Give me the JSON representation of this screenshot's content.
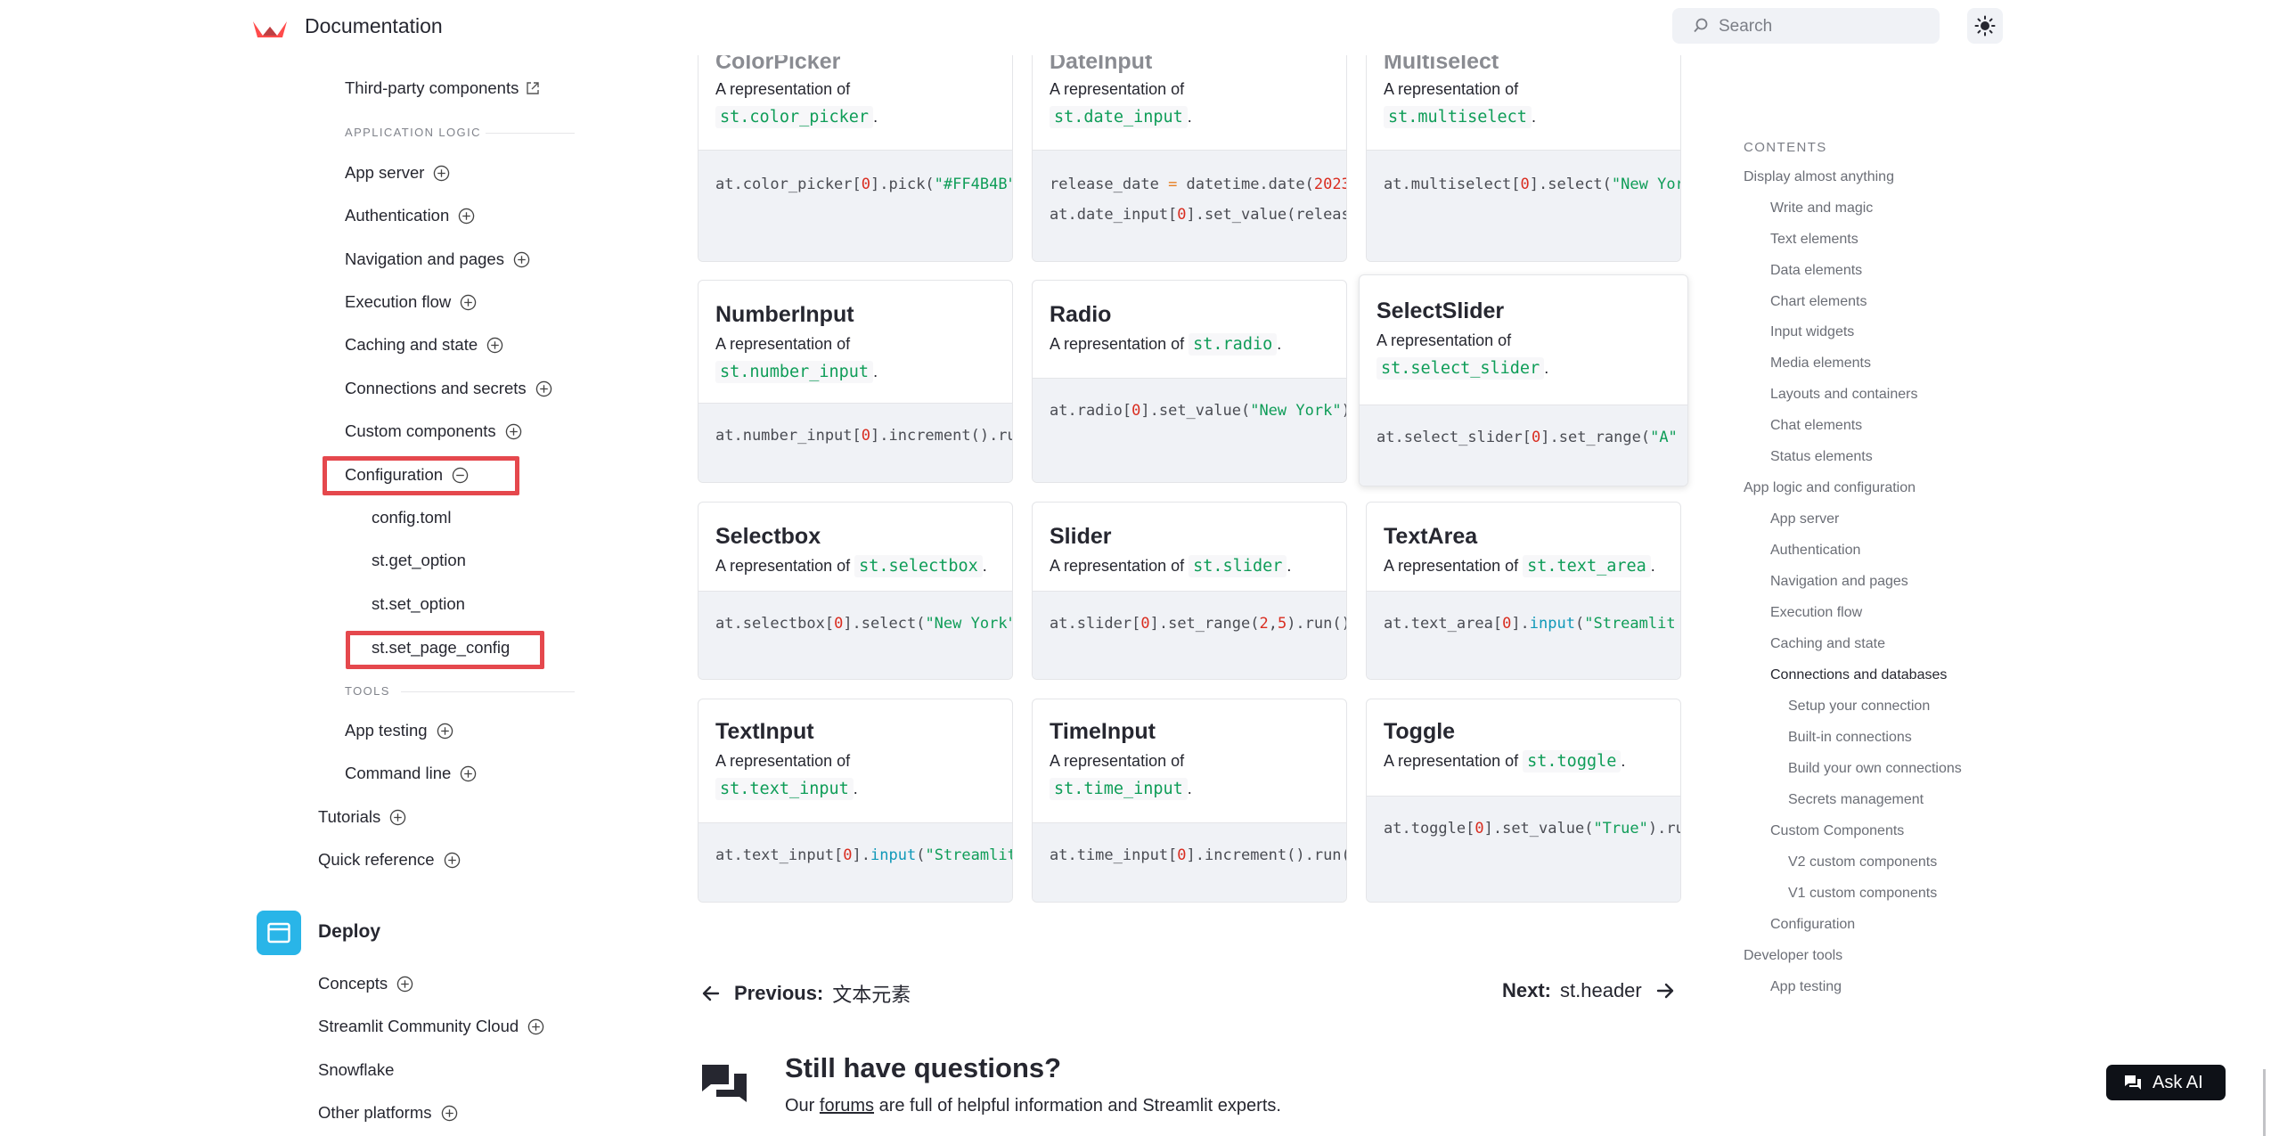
{
  "header": {
    "title": "Documentation",
    "search_placeholder": "Search"
  },
  "sidebar": {
    "third_party": "Third-party components",
    "application_logic_label": "APPLICATION LOGIC",
    "app_server": "App server",
    "authentication": "Authentication",
    "navigation": "Navigation and pages",
    "execution_flow": "Execution flow",
    "caching": "Caching and state",
    "connections": "Connections and secrets",
    "custom_components": "Custom components",
    "configuration": "Configuration",
    "config_toml": "config.toml",
    "get_option": "st.get_option",
    "set_option": "st.set_option",
    "set_page_config": "st.set_page_config",
    "tools_label": "TOOLS",
    "app_testing": "App testing",
    "command_line": "Command line",
    "tutorials": "Tutorials",
    "quick_reference": "Quick reference",
    "deploy": "Deploy",
    "concepts": "Concepts",
    "community_cloud": "Streamlit Community Cloud",
    "snowflake": "Snowflake",
    "other_platforms": "Other platforms"
  },
  "cards": {
    "rep_of": "A representation of",
    "color_picker": {
      "title": "ColorPicker",
      "api": "st.color_picker"
    },
    "date_input": {
      "title": "DateInput",
      "api": "st.date_input"
    },
    "multiselect": {
      "title": "Multiselect",
      "api": "st.multiselect"
    },
    "number_input": {
      "title": "NumberInput",
      "api": "st.number_input"
    },
    "radio": {
      "title": "Radio",
      "api": "st.radio"
    },
    "select_slider": {
      "title": "SelectSlider",
      "api": "st.select_slider"
    },
    "selectbox": {
      "title": "Selectbox",
      "api": "st.selectbox"
    },
    "slider": {
      "title": "Slider",
      "api": "st.slider"
    },
    "text_area": {
      "title": "TextArea",
      "api": "st.text_area"
    },
    "text_input": {
      "title": "TextInput",
      "api": "st.text_input"
    },
    "time_input": {
      "title": "TimeInput",
      "api": "st.time_input"
    },
    "toggle": {
      "title": "Toggle",
      "api": "st.toggle"
    }
  },
  "pagination": {
    "prev_label": "Previous:",
    "prev_title": "文本元素",
    "next_label": "Next:",
    "next_title": "st.header"
  },
  "help": {
    "title": "Still have questions?",
    "text_before": "Our",
    "link": "forums",
    "text_after": "are full of helpful information and Streamlit experts."
  },
  "toc": {
    "heading": "CONTENTS",
    "display": "Display almost anything",
    "write_magic": "Write and magic",
    "text_elements": "Text elements",
    "data_elements": "Data elements",
    "chart_elements": "Chart elements",
    "input_widgets": "Input widgets",
    "media_elements": "Media elements",
    "layouts": "Layouts and containers",
    "chat_elements": "Chat elements",
    "status_elements": "Status elements",
    "app_logic": "App logic and configuration",
    "app_server": "App server",
    "authentication": "Authentication",
    "navigation": "Navigation and pages",
    "execution_flow": "Execution flow",
    "caching": "Caching and state",
    "connections_db": "Connections and databases",
    "setup_connection": "Setup your connection",
    "builtin_connections": "Built-in connections",
    "build_own": "Build your own connections",
    "secrets": "Secrets management",
    "custom_components": "Custom Components",
    "v2": "V2 custom components",
    "v1": "V1 custom components",
    "configuration": "Configuration",
    "developer_tools": "Developer tools",
    "app_testing": "App testing"
  },
  "ask_ai": "Ask AI",
  "colors": {
    "accent": "#ff4b4b",
    "highlight": "#e5484d",
    "deploy": "#29b5e8",
    "code_green": "#0f9d58"
  }
}
